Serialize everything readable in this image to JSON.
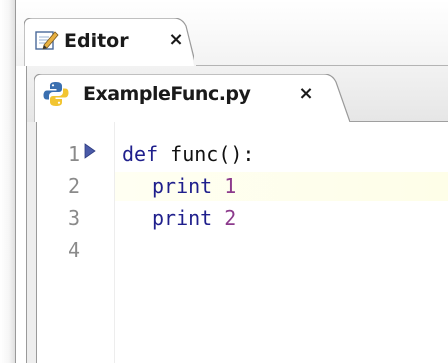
{
  "outer_tab": {
    "label": "Editor",
    "close_glyph": "×",
    "icon": "editor-pencil-icon"
  },
  "file_tab": {
    "label": "ExampleFunc.py",
    "close_glyph": "×",
    "icon": "python-icon"
  },
  "editor": {
    "line_numbers": [
      "1",
      "2",
      "3",
      "4"
    ],
    "fold_marker": "fold-triangle-icon",
    "lines": [
      {
        "keyword": "def",
        "rest": " func():"
      },
      {
        "keyword": "print",
        "number": "1"
      },
      {
        "keyword": "print",
        "number": "2"
      },
      {
        "keyword": "",
        "number": ""
      }
    ],
    "current_line_highlight": "#fefee8"
  },
  "colors": {
    "keyword": "#1f1f8c",
    "number": "#8c3a8c",
    "line_number": "#8a8a8a",
    "python_blue": "#3a6fb0",
    "python_yellow": "#f2c531"
  }
}
